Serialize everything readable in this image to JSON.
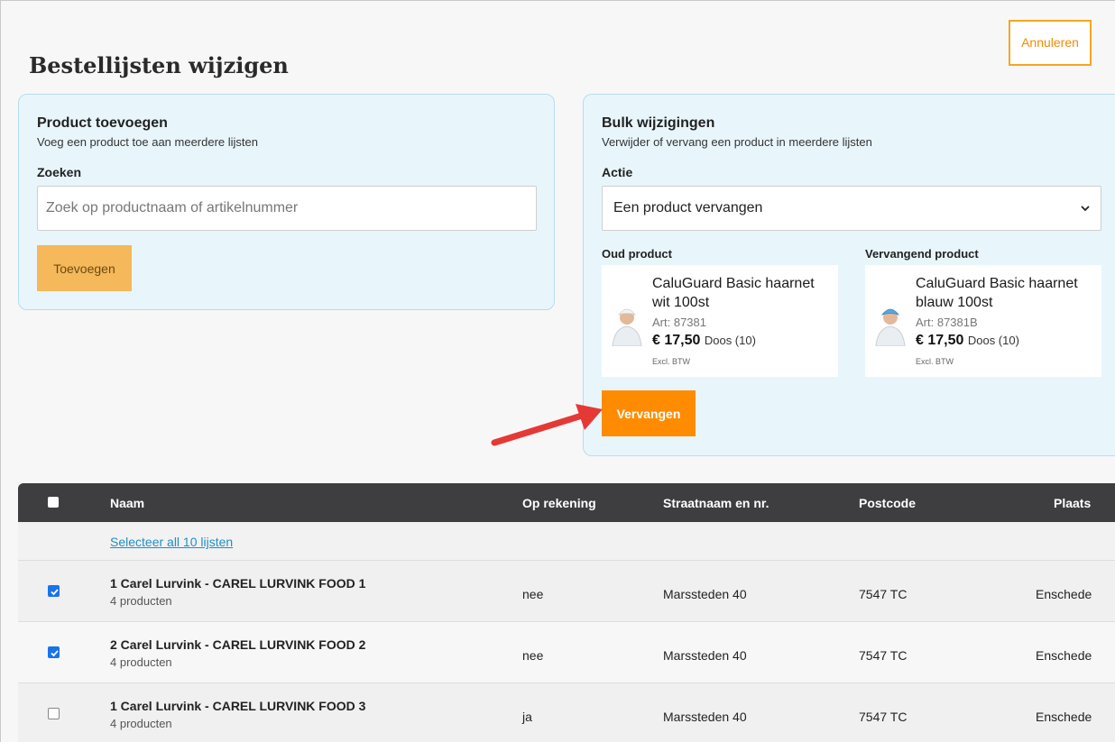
{
  "header": {
    "title": "Bestellijsten wijzigen",
    "cancel_label": "Annuleren"
  },
  "add_panel": {
    "title": "Product toevoegen",
    "subtitle": "Voeg een product toe aan meerdere lijsten",
    "search_label": "Zoeken",
    "search_placeholder": "Zoek op productnaam of artikelnummer",
    "add_label": "Toevoegen"
  },
  "bulk_panel": {
    "title": "Bulk wijzigingen",
    "subtitle": "Verwijder of vervang een product in meerdere lijsten",
    "action_label": "Actie",
    "action_selected": "Een product vervangen",
    "old_label": "Oud product",
    "new_label": "Vervangend product",
    "old_product": {
      "name": "CaluGuard Basic haarnet wit 100st",
      "art": "Art: 87381",
      "price": "€ 17,50",
      "unit": "Doos (10)",
      "vat": "Excl. BTW"
    },
    "new_product": {
      "name": "CaluGuard Basic haarnet blauw 100st",
      "art": "Art: 87381B",
      "price": "€ 17,50",
      "unit": "Doos (10)",
      "vat": "Excl. BTW"
    },
    "replace_label": "Vervangen"
  },
  "table": {
    "headers": {
      "name": "Naam",
      "account": "Op rekening",
      "street": "Straatnaam en nr.",
      "postcode": "Postcode",
      "city": "Plaats"
    },
    "select_all_label": "Selecteer all 10 lijsten",
    "rows": [
      {
        "checked": true,
        "name": "1 Carel Lurvink - CAREL LURVINK FOOD 1",
        "count": "4 producten",
        "account": "nee",
        "street": "Marssteden 40",
        "postcode": "7547 TC",
        "city": "Enschede"
      },
      {
        "checked": true,
        "name": "2 Carel Lurvink - CAREL LURVINK FOOD 2",
        "count": "4 producten",
        "account": "nee",
        "street": "Marssteden 40",
        "postcode": "7547 TC",
        "city": "Enschede"
      },
      {
        "checked": false,
        "name": "1 Carel Lurvink - CAREL LURVINK FOOD 3",
        "count": "4 producten",
        "account": "ja",
        "street": "Marssteden 40",
        "postcode": "7547 TC",
        "city": "Enschede"
      }
    ]
  },
  "colors": {
    "accent_orange": "#ff8c00",
    "panel_bg": "#e8f6fc",
    "table_header": "#3e3e40",
    "link_blue": "#1f8fc4",
    "annotation_arrow": "#e53935"
  },
  "icons": [
    "chevron-down-icon",
    "checkbox-checked-icon",
    "checkbox-empty-icon",
    "annotation-arrow-icon"
  ]
}
